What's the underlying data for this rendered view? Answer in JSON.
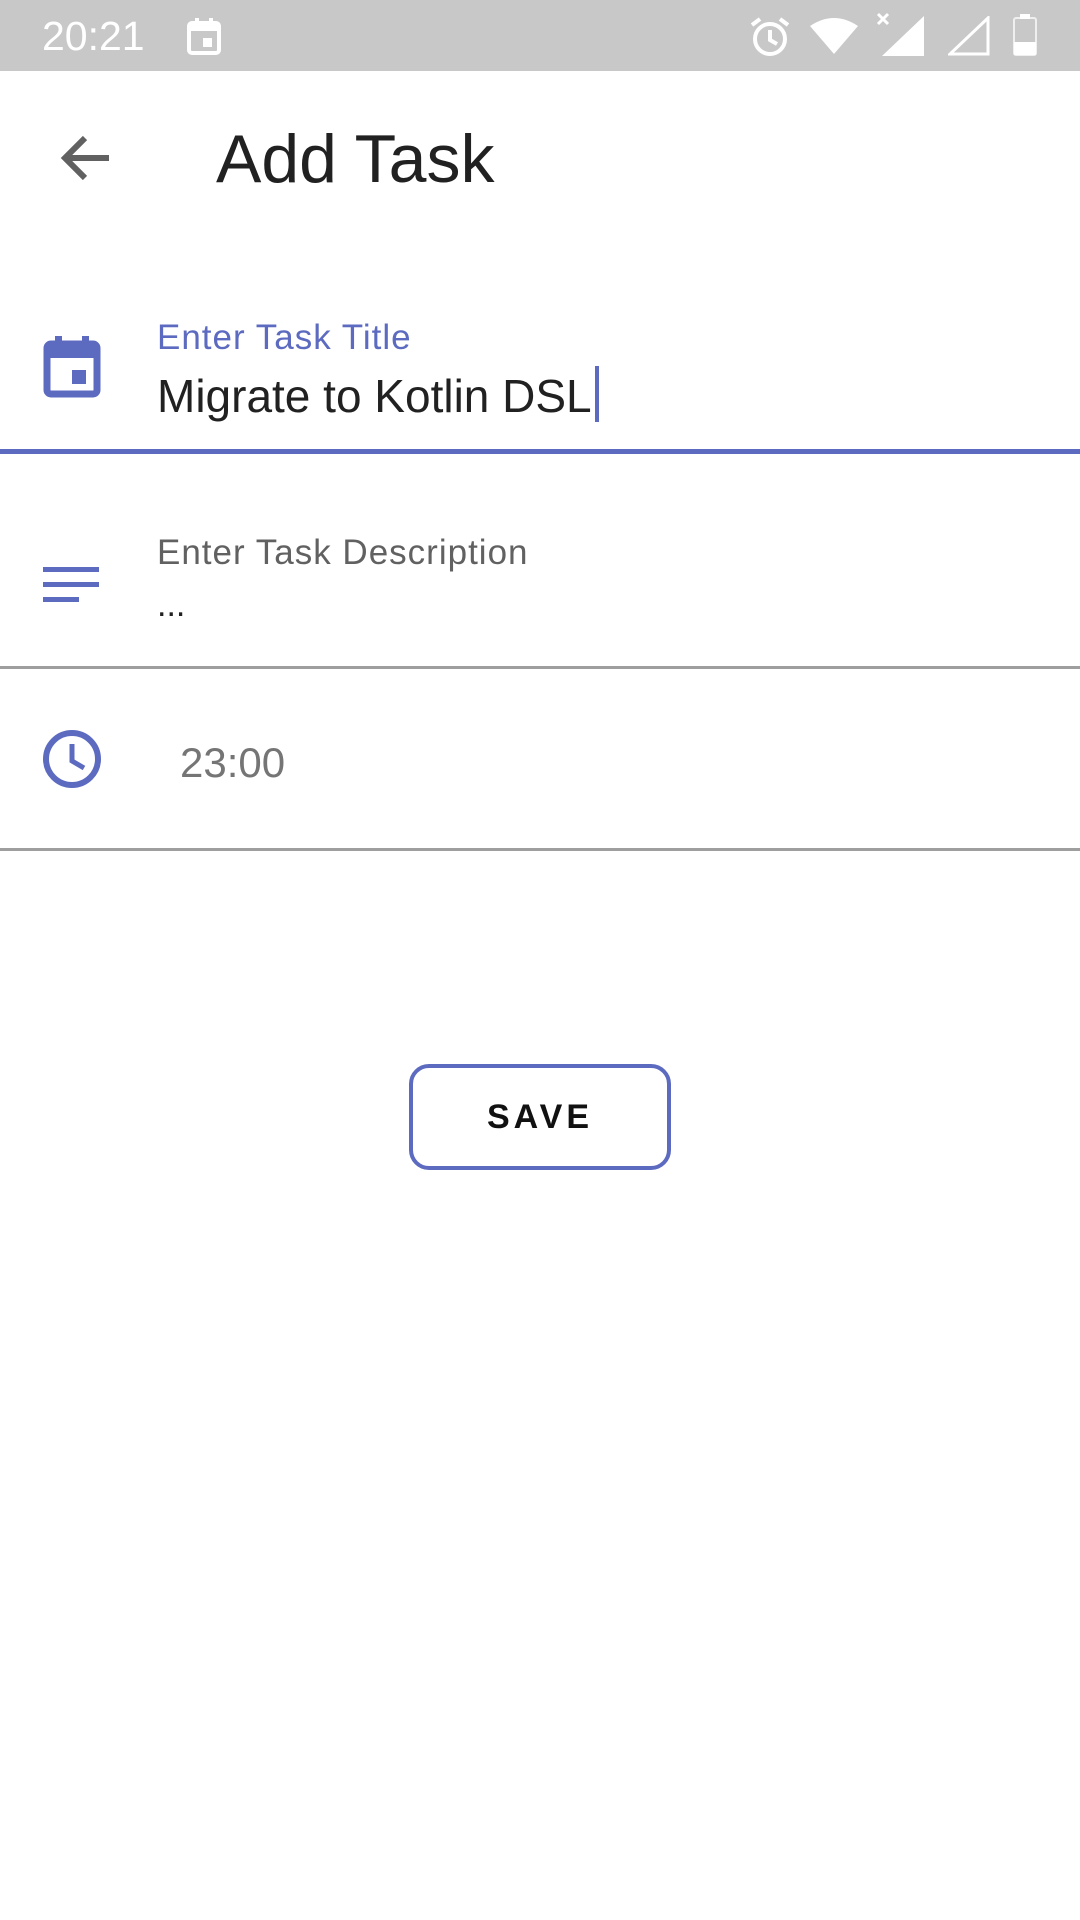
{
  "status_bar": {
    "time": "20:21",
    "icons": [
      "calendar-notification-icon",
      "alarm-icon",
      "wifi-icon",
      "cell-signal-no-data-icon",
      "cell-signal-empty-icon",
      "battery-icon"
    ],
    "background": "#c8c8c8"
  },
  "app_bar": {
    "title": "Add Task",
    "back_icon": "arrow-back-icon"
  },
  "form": {
    "title_field": {
      "label": "Enter Task Title",
      "value": "Migrate to Kotlin DSL",
      "icon": "calendar-icon",
      "focused": true
    },
    "description_field": {
      "label": "Enter Task Description",
      "value": "...",
      "icon": "notes-icon"
    },
    "time_field": {
      "value": "23:00",
      "icon": "clock-icon"
    }
  },
  "actions": {
    "save_label": "SAVE"
  },
  "colors": {
    "accent": "#5c6bc0",
    "label_inactive": "#616161",
    "divider": "#9e9e9e",
    "text": "#212121"
  }
}
